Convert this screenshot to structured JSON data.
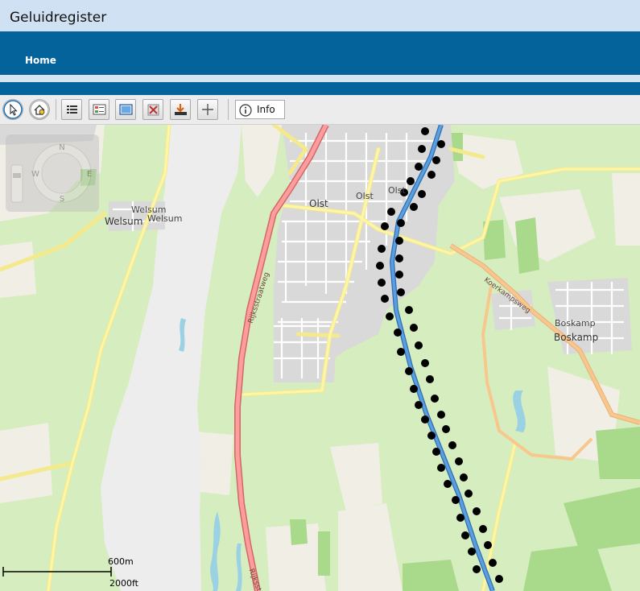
{
  "app": {
    "title": "Geluidregister"
  },
  "nav": {
    "home_label": "Home"
  },
  "toolbar": {
    "tools": [
      {
        "name": "select-arrow-icon"
      },
      {
        "name": "home-extent-icon"
      },
      {
        "name": "layer-list-icon"
      },
      {
        "name": "legend-icon"
      },
      {
        "name": "map-window-icon"
      },
      {
        "name": "clear-selection-icon"
      },
      {
        "name": "download-icon"
      },
      {
        "name": "crosshair-icon"
      }
    ],
    "info_label": "Info"
  },
  "map": {
    "labels": {
      "welsum_1": "Welsum",
      "welsum_2": "Welsum",
      "welsum_3": "Welsum",
      "olst_1": "Olst",
      "olst_2": "Olst",
      "olst_3": "Olst",
      "boskamp_1": "Boskamp",
      "boskamp_2": "Boskamp",
      "rijksstraatweg_1": "Rijksstraatweg",
      "rijksstraatweg_2": "Rijksstr",
      "koerkampsweg": "Koerkampsweg"
    },
    "compass": {
      "n": "N",
      "e": "E",
      "s": "S",
      "w": "W"
    },
    "scale": {
      "metric": "600m",
      "imperial": "2000ft"
    },
    "colors": {
      "grass": "#d6eebf",
      "farmland": "#f1eee6",
      "forest": "#a9d98a",
      "built": "#d9d9d9",
      "river": "#ededed",
      "water": "#9ad2e4",
      "provincial_road": "#ff9c9c",
      "local_road": "#fdf6a7",
      "secondary_road": "#f7c78e",
      "railway": "#5c9fe0",
      "noise_marker": "#000000"
    }
  }
}
